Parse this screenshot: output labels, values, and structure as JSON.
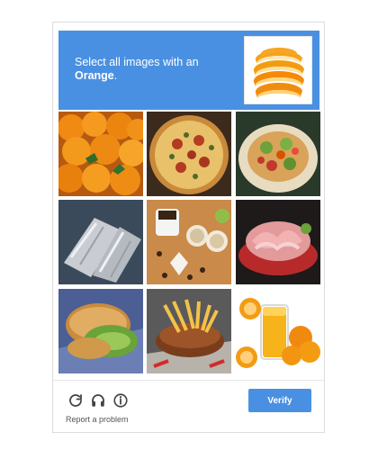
{
  "challenge": {
    "prompt_line1": "Select all images with an",
    "prompt_target": "Orange",
    "prompt_period": ".",
    "example_image_icon": "orange-slices-image"
  },
  "tiles": [
    {
      "name": "tile-oranges-pile",
      "subject": "oranges"
    },
    {
      "name": "tile-pizza",
      "subject": "pizza"
    },
    {
      "name": "tile-salad-bowl",
      "subject": "salad"
    },
    {
      "name": "tile-foil-wrapped-food",
      "subject": "foil-wrapped food"
    },
    {
      "name": "tile-coffee-cookies",
      "subject": "coffee and cookies"
    },
    {
      "name": "tile-ham-platter",
      "subject": "ham platter"
    },
    {
      "name": "tile-sandwich",
      "subject": "sandwich"
    },
    {
      "name": "tile-fries-burger",
      "subject": "fries and burger"
    },
    {
      "name": "tile-orange-juice",
      "subject": "orange juice and oranges"
    }
  ],
  "footer": {
    "reload_icon": "reload-icon",
    "audio_icon": "headphones-icon",
    "info_icon": "info-icon",
    "report_label": "Report a problem",
    "verify_label": "Verify"
  },
  "colors": {
    "accent": "#4a90e2"
  }
}
